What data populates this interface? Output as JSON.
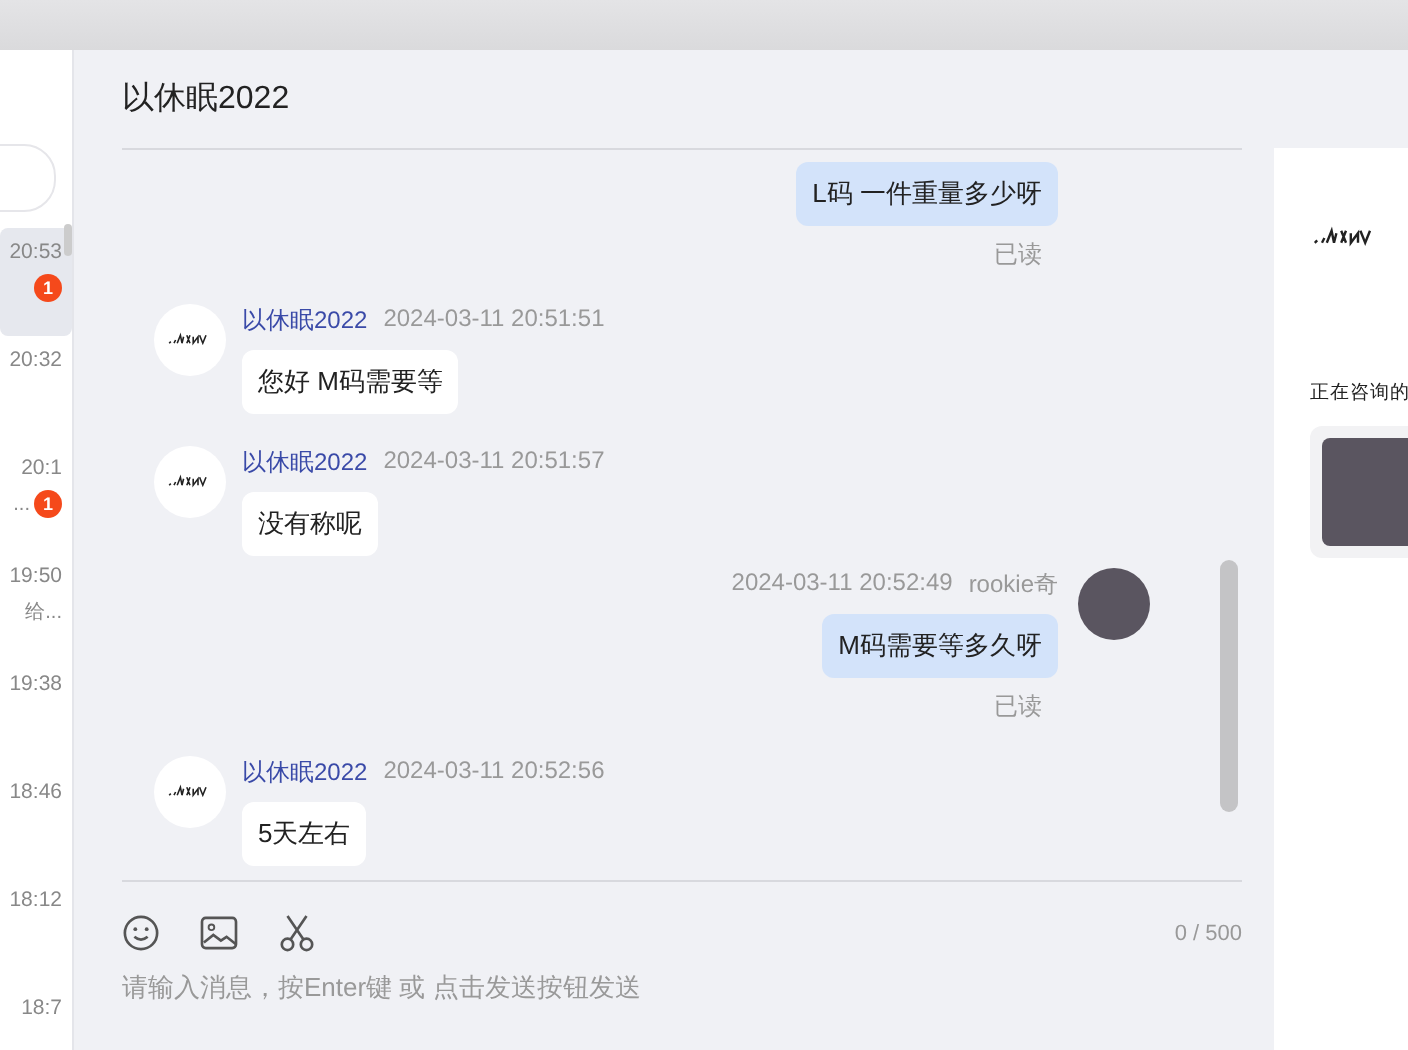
{
  "conversations": [
    {
      "time": "20:53",
      "badge": "1",
      "selected": true
    },
    {
      "time": "20:32",
      "selected": false
    },
    {
      "time": "20:1",
      "snippet": "...",
      "badge": "1",
      "selected": false
    },
    {
      "time": "19:50",
      "snippet": "给...",
      "selected": false
    },
    {
      "time": "19:38",
      "selected": false
    },
    {
      "time": "18:46",
      "selected": false
    },
    {
      "time": "18:12",
      "selected": false
    },
    {
      "time": "18:7",
      "selected": false
    }
  ],
  "chat": {
    "title": "以休眠2022",
    "messages": [
      {
        "kind": "sent",
        "text": "L码 一件重量多少呀",
        "status": "已读"
      },
      {
        "kind": "received",
        "name": "以休眠2022",
        "time": "2024-03-11 20:51:51",
        "text": "您好 M码需要等"
      },
      {
        "kind": "received",
        "name": "以休眠2022",
        "time": "2024-03-11 20:51:57",
        "text": "没有称呢"
      },
      {
        "kind": "sent",
        "time": "2024-03-11 20:52:49",
        "name": "rookie奇",
        "text": "M码需要等多久呀",
        "status": "已读"
      },
      {
        "kind": "received",
        "name": "以休眠2022",
        "time": "2024-03-11 20:52:56",
        "text": "5天左右"
      }
    ],
    "counter": "0 / 500",
    "placeholder": "请输入消息，按Enter键 或 点击发送按钮发送"
  },
  "side_panel": {
    "heading": "正在咨询的"
  }
}
